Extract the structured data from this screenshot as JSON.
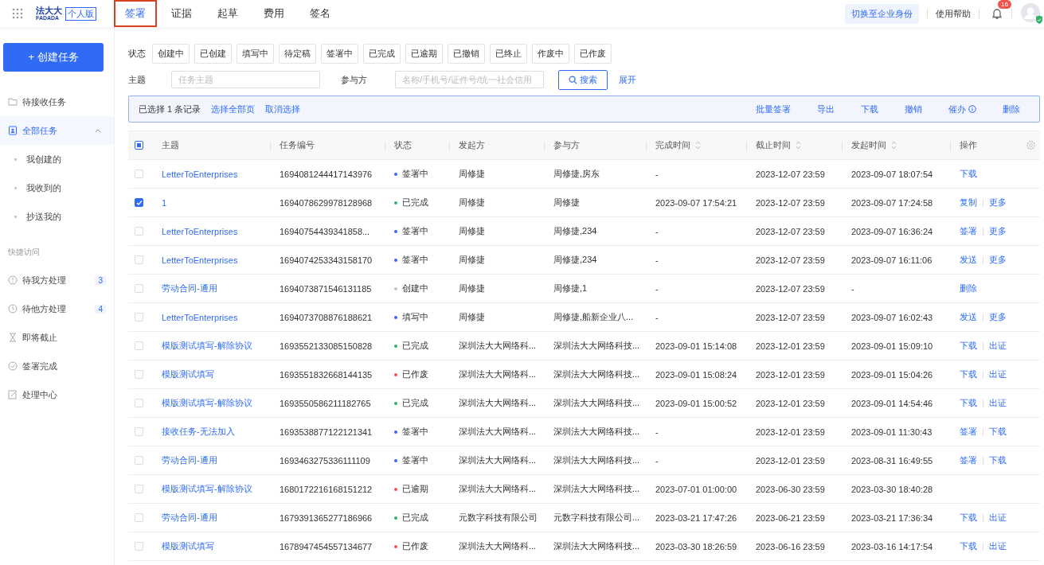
{
  "topbar": {
    "brand": "法大大",
    "brand_sub": "FADADA",
    "edition": "个人版",
    "tabs": [
      {
        "label": "签署",
        "selected": true,
        "highlighted": true
      },
      {
        "label": "证据",
        "selected": false,
        "highlighted": false
      },
      {
        "label": "起草",
        "selected": false,
        "highlighted": false
      },
      {
        "label": "费用",
        "selected": false,
        "highlighted": false
      },
      {
        "label": "签名",
        "selected": false,
        "highlighted": false
      }
    ],
    "switch_button": "切换至企业身份",
    "help": "使用帮助",
    "notification_count": "16"
  },
  "sidebar": {
    "create_button": "+ 创建任务",
    "items": [
      {
        "label": "待接收任务",
        "kind": "item",
        "selected": false
      },
      {
        "label": "全部任务",
        "kind": "group",
        "selected": true,
        "expanded": true,
        "children": [
          {
            "label": "我创建的",
            "selected": false
          },
          {
            "label": "我收到的",
            "selected": false
          },
          {
            "label": "抄送我的",
            "selected": false
          }
        ]
      }
    ],
    "quick_title": "快捷访问",
    "quick_items": [
      {
        "label": "待我方处理",
        "badge": "3"
      },
      {
        "label": "待他方处理",
        "badge": "4"
      },
      {
        "label": "即将截止"
      },
      {
        "label": "签署完成"
      },
      {
        "label": "处理中心"
      }
    ]
  },
  "filters": {
    "status_label": "状态",
    "statuses": [
      {
        "label": "创建中",
        "selected": false
      },
      {
        "label": "已创建",
        "selected": false
      },
      {
        "label": "填写中",
        "selected": false
      },
      {
        "label": "待定稿",
        "selected": false
      },
      {
        "label": "签署中",
        "selected": false
      },
      {
        "label": "已完成",
        "selected": false
      },
      {
        "label": "已逾期",
        "selected": false
      },
      {
        "label": "已撤销",
        "selected": false
      },
      {
        "label": "已终止",
        "selected": false
      },
      {
        "label": "作废中",
        "selected": false
      },
      {
        "label": "已作废",
        "selected": false
      }
    ],
    "subject_label": "主题",
    "subject_placeholder": "任务主题",
    "party_label": "参与方",
    "party_placeholder": "名称/手机号/证件号/统一社会信用",
    "search_button": "搜索",
    "expand_link": "展开"
  },
  "selection_bar": {
    "text": "已选择 1 条记录",
    "select_all": "选择全部页",
    "cancel": "取消选择",
    "actions": [
      {
        "label": "批量签署",
        "info": false
      },
      {
        "label": "导出",
        "info": false
      },
      {
        "label": "下载",
        "info": false
      },
      {
        "label": "撤销",
        "info": false
      },
      {
        "label": "催办",
        "info": true
      },
      {
        "label": "删除",
        "info": false
      }
    ]
  },
  "table": {
    "select_all": {
      "indeterminate": true
    },
    "columns": [
      {
        "label": "主题",
        "sortable": false
      },
      {
        "label": "任务编号",
        "sortable": false
      },
      {
        "label": "状态",
        "sortable": false
      },
      {
        "label": "发起方",
        "sortable": false
      },
      {
        "label": "参与方",
        "sortable": false
      },
      {
        "label": "完成时间",
        "sortable": true
      },
      {
        "label": "截止时间",
        "sortable": true
      },
      {
        "label": "发起时间",
        "sortable": true
      },
      {
        "label": "操作",
        "sortable": false
      }
    ],
    "rows": [
      {
        "selected": false,
        "subject": "LetterToEnterprises",
        "id": "1694081244417143976",
        "status": "签署中",
        "color": "#2f6bf5",
        "initiator": "周修捷",
        "parties": "周修捷,房东",
        "completed": "-",
        "deadline": "2023-12-07 23:59",
        "started": "2023-09-07 18:07:54",
        "actions": [
          "下载"
        ]
      },
      {
        "selected": true,
        "subject": "1",
        "id": "1694078629978128968",
        "status": "已完成",
        "color": "#2fb36b",
        "initiator": "周修捷",
        "parties": "周修捷",
        "completed": "2023-09-07 17:54:21",
        "deadline": "2023-12-07 23:59",
        "started": "2023-09-07 17:24:58",
        "actions": [
          "复制",
          "更多"
        ]
      },
      {
        "selected": false,
        "subject": "LetterToEnterprises",
        "id": "16940754439341858...",
        "status": "签署中",
        "color": "#2f6bf5",
        "initiator": "周修捷",
        "parties": "周修捷,234",
        "completed": "-",
        "deadline": "2023-12-07 23:59",
        "started": "2023-09-07 16:36:24",
        "actions": [
          "签署",
          "更多"
        ]
      },
      {
        "selected": false,
        "subject": "LetterToEnterprises",
        "id": "1694074253343158170",
        "status": "签署中",
        "color": "#2f6bf5",
        "initiator": "周修捷",
        "parties": "周修捷,234",
        "completed": "-",
        "deadline": "2023-12-07 23:59",
        "started": "2023-09-07 16:11:06",
        "actions": [
          "发送",
          "更多"
        ]
      },
      {
        "selected": false,
        "subject": "劳动合同-通用",
        "id": "1694073871546131185",
        "status": "创建中",
        "color": "#c0c4cc",
        "initiator": "周修捷",
        "parties": "周修捷,1",
        "completed": "-",
        "deadline": "2023-12-07 23:59",
        "started": "-",
        "actions": [
          "删除"
        ]
      },
      {
        "selected": false,
        "subject": "LetterToEnterprises",
        "id": "1694073708876188621",
        "status": "填写中",
        "color": "#2f6bf5",
        "initiator": "周修捷",
        "parties": "周修捷,船新企业八...",
        "completed": "-",
        "deadline": "2023-12-07 23:59",
        "started": "2023-09-07 16:02:43",
        "actions": [
          "发送",
          "更多"
        ]
      },
      {
        "selected": false,
        "subject": "模版测试填写-解除协议",
        "id": "1693552133085150828",
        "status": "已完成",
        "color": "#2fb36b",
        "initiator": "深圳法大大网络科...",
        "parties": "深圳法大大网络科技...",
        "completed": "2023-09-01 15:14:08",
        "deadline": "2023-12-01 23:59",
        "started": "2023-09-01 15:09:10",
        "actions": [
          "下载",
          "出证"
        ]
      },
      {
        "selected": false,
        "subject": "模版测试填写",
        "id": "1693551832668144135",
        "status": "已作废",
        "color": "#f0564d",
        "initiator": "深圳法大大网络科...",
        "parties": "深圳法大大网络科技...",
        "completed": "2023-09-01 15:08:24",
        "deadline": "2023-12-01 23:59",
        "started": "2023-09-01 15:04:26",
        "actions": [
          "下载",
          "出证"
        ]
      },
      {
        "selected": false,
        "subject": "模版测试填写-解除协议",
        "id": "1693550586211182765",
        "status": "已完成",
        "color": "#2fb36b",
        "initiator": "深圳法大大网络科...",
        "parties": "深圳法大大网络科技...",
        "completed": "2023-09-01 15:00:52",
        "deadline": "2023-12-01 23:59",
        "started": "2023-09-01 14:54:46",
        "actions": [
          "下载",
          "出证"
        ]
      },
      {
        "selected": false,
        "subject": "接收任务-无法加入",
        "id": "1693538877122121341",
        "status": "签署中",
        "color": "#2f6bf5",
        "initiator": "深圳法大大网络科...",
        "parties": "深圳法大大网络科技...",
        "completed": "-",
        "deadline": "2023-12-01 23:59",
        "started": "2023-09-01 11:30:43",
        "actions": [
          "签署",
          "下载"
        ]
      },
      {
        "selected": false,
        "subject": "劳动合同-通用",
        "id": "1693463275336111109",
        "status": "签署中",
        "color": "#2f6bf5",
        "initiator": "深圳法大大网络科...",
        "parties": "深圳法大大网络科技...",
        "completed": "-",
        "deadline": "2023-12-01 23:59",
        "started": "2023-08-31 16:49:55",
        "actions": [
          "签署",
          "下载"
        ]
      },
      {
        "selected": false,
        "subject": "模版测试填写-解除协议",
        "id": "1680172216168151212",
        "status": "已逾期",
        "color": "#f0564d",
        "initiator": "深圳法大大网络科...",
        "parties": "深圳法大大网络科技...",
        "completed": "2023-07-01 01:00:00",
        "deadline": "2023-06-30 23:59",
        "started": "2023-03-30 18:40:28",
        "actions": []
      },
      {
        "selected": false,
        "subject": "劳动合同-通用",
        "id": "1679391365277186966",
        "status": "已完成",
        "color": "#2fb36b",
        "initiator": "元数字科技有限公司",
        "parties": "元数字科技有限公司...",
        "completed": "2023-03-21 17:47:26",
        "deadline": "2023-06-21 23:59",
        "started": "2023-03-21 17:36:34",
        "actions": [
          "下载",
          "出证"
        ]
      },
      {
        "selected": false,
        "subject": "模版测试填写",
        "id": "1678947454557134677",
        "status": "已作废",
        "color": "#f0564d",
        "initiator": "深圳法大大网络科...",
        "parties": "深圳法大大网络科技...",
        "completed": "2023-03-30 18:26:59",
        "deadline": "2023-06-16 23:59",
        "started": "2023-03-16 14:17:54",
        "actions": [
          "下载",
          "出证"
        ]
      }
    ]
  }
}
